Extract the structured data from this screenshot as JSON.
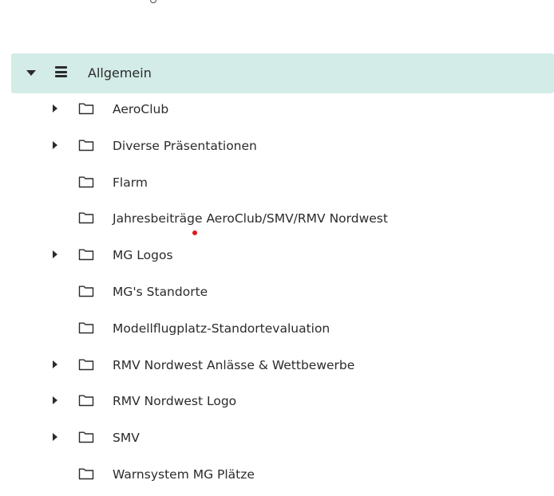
{
  "tree": {
    "root": {
      "label": "Allgemein",
      "expanded": true,
      "icon": "list-icon"
    },
    "items": [
      {
        "label": "AeroClub",
        "has_children": true
      },
      {
        "label": "Diverse Präsentationen",
        "has_children": true
      },
      {
        "label": "Flarm",
        "has_children": false
      },
      {
        "label": "Jahresbeiträge AeroClub/SMV/RMV Nordwest",
        "has_children": false
      },
      {
        "label": "MG Logos",
        "has_children": true
      },
      {
        "label": "MG's Standorte",
        "has_children": false
      },
      {
        "label": "Modellflugplatz-Standortevaluation",
        "has_children": false
      },
      {
        "label": "RMV Nordwest Anlässe & Wettbewerbe",
        "has_children": true
      },
      {
        "label": "RMV Nordwest Logo",
        "has_children": true
      },
      {
        "label": "SMV",
        "has_children": true
      },
      {
        "label": "Warnsystem MG Plätze",
        "has_children": false
      }
    ]
  },
  "colors": {
    "selected_row_bg": "#d3ece7",
    "text": "#2b2b2b",
    "cursor_dot": "#e01818"
  }
}
